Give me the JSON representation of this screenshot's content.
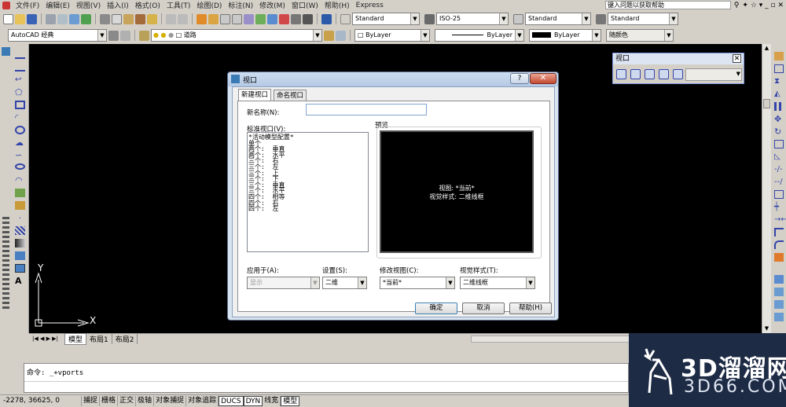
{
  "menubar": {
    "items": [
      "文件(F)",
      "编辑(E)",
      "视图(V)",
      "插入(I)",
      "格式(O)",
      "工具(T)",
      "绘图(D)",
      "标注(N)",
      "修改(M)",
      "窗口(W)",
      "帮助(H)",
      "Express"
    ],
    "help_search": "键入问题以获取帮助"
  },
  "toolbar1": {
    "textstyle": "Standard",
    "dimstyle": "ISO-25",
    "tablestyle": "Standard",
    "mleaderstyle": "Standard"
  },
  "toolbar2": {
    "workspace": "AutoCAD 经典",
    "layer": "道路",
    "color": "ByLayer",
    "linetype": "ByLayer",
    "lineweight": "ByLayer",
    "plotstyle": "随颜色"
  },
  "viewport_toolbar": {
    "title": "视口"
  },
  "canvas": {
    "y_axis": "Y",
    "x_axis": "X"
  },
  "layout_tabs": {
    "model": "模型",
    "layout1": "布局1",
    "layout2": "布局2"
  },
  "command": {
    "line": "命令: _+vports"
  },
  "status": {
    "coords": "-2278,  36625, 0",
    "items": [
      "捕捉",
      "栅格",
      "正交",
      "极轴",
      "对象捕捉",
      "对象追踪",
      "DUCS",
      "DYN",
      "线宽",
      "模型"
    ]
  },
  "dialog": {
    "title": "视口",
    "tab_new": "新建视口",
    "tab_named": "命名视口",
    "name_label": "新名称(N):",
    "name_value": "",
    "std_label": "标准视口(V):",
    "std_items": [
      "*活动模型配置*",
      "单个",
      "两个:  垂直",
      "两个:  水平",
      "三个:  右",
      "三个:  左",
      "三个:  上",
      "三个:  下",
      "三个:  垂直",
      "三个:  水平",
      "四个:  相等",
      "四个:  右",
      "四个:  左"
    ],
    "preview_label": "预览",
    "preview_line1": "视图: *当前*",
    "preview_line2": "视觉样式: 二维线框",
    "apply_label": "应用于(A):",
    "apply_value": "显示",
    "setup_label": "设置(S):",
    "setup_value": "二维",
    "change_view_label": "修改视图(C):",
    "change_view_value": "*当前*",
    "visual_style_label": "视觉样式(T):",
    "visual_style_value": "二维线框",
    "ok": "确定",
    "cancel": "取消",
    "help": "帮助(H)"
  },
  "watermark": {
    "brand_cn": "3D溜溜网",
    "brand_en": "3D66.COM"
  }
}
